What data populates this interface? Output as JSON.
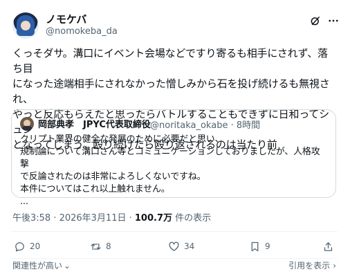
{
  "post": {
    "display_name": "ノモケバ",
    "handle": "@nomokeba_da",
    "text": "くっそダサ。溝口にイベント会場などですり寄るも相手にされず、落ち目\nになった途端相手にされなかった憎しみから石を投げ続けるも無視され、\nやっと反応もらえたと思ったらバトルすることもできずに日和ってシュン\nとなってしまう。殴り続けたら殴り返されるのは当たり前"
  },
  "quote": {
    "display_name": "岡部典孝　JPYC代表取締役",
    "handle_time": "@noritaka_okabe · 8時間",
    "text": "クリプト業界の健全な発展のために必要だと思い、\n規制論について溝口さん等とコミュニケーションしておりましたが、人格攻撃\nで反論されたのは非常によろしくないですね。\n本件についてはこれ以上触れません。\n..."
  },
  "meta": {
    "time": "午後3:58 · 2026年3月11日 · ",
    "views": "100.7万",
    "views_suffix": " 件の表示"
  },
  "actions": {
    "replies": "20",
    "reposts": "8",
    "likes": "34",
    "bookmarks": "9"
  },
  "footer": {
    "left": "関連性が高い",
    "right": "引用を表示"
  },
  "icons": [
    "grok-icon",
    "more-icon",
    "reply-icon",
    "repost-icon",
    "like-icon",
    "bookmark-icon",
    "share-icon",
    "chevron-down-icon",
    "chevron-right-icon"
  ]
}
